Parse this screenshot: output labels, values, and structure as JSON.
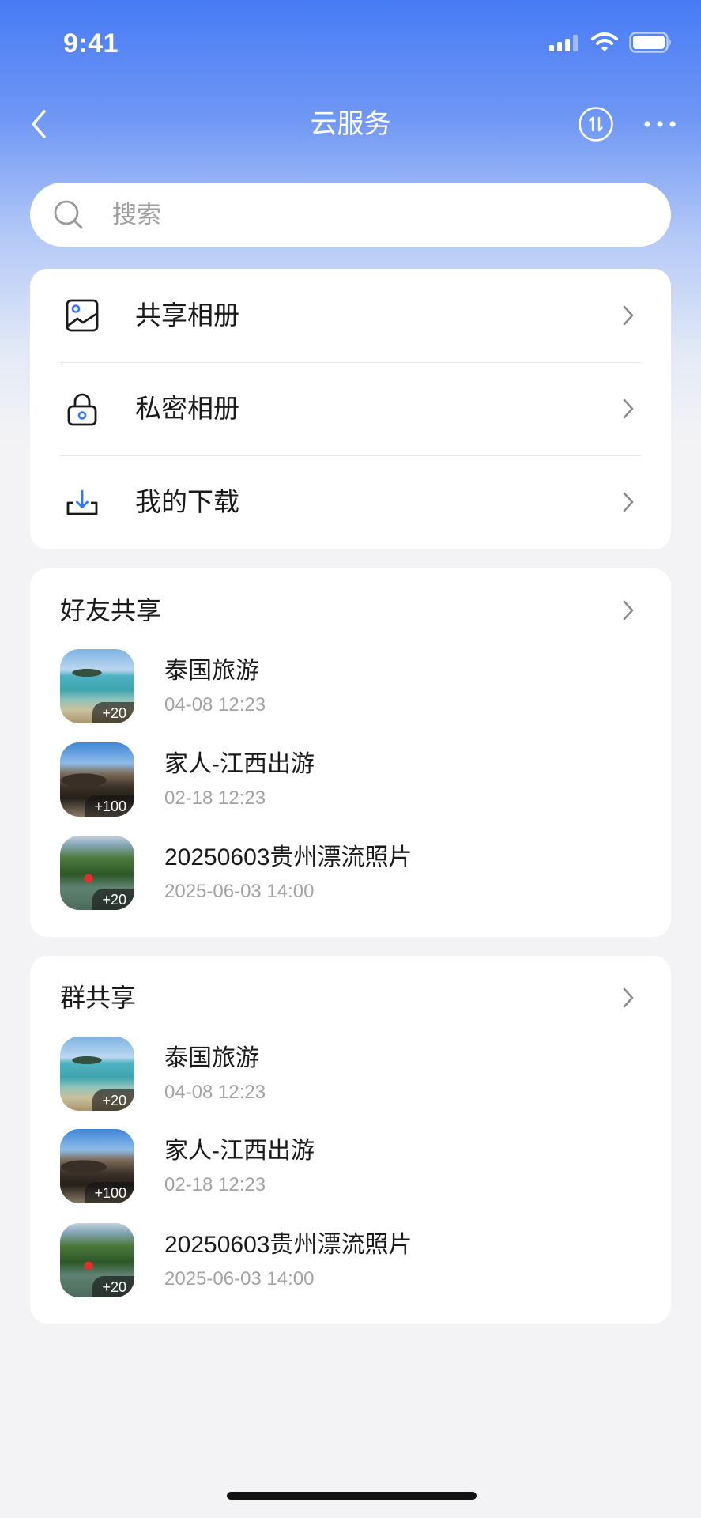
{
  "status_bar": {
    "time": "9:41",
    "icons": [
      "signal-icon",
      "wifi-icon",
      "battery-icon"
    ]
  },
  "nav": {
    "title": "云服务",
    "icons": {
      "back": "chevron-left-icon",
      "sort": "sort-icon",
      "more": "more-icon"
    }
  },
  "search": {
    "placeholder": "搜索",
    "icon": "search-icon"
  },
  "menu": [
    {
      "label": "共享相册",
      "icon": "image-icon"
    },
    {
      "label": "私密相册",
      "icon": "lock-icon"
    },
    {
      "label": "我的下载",
      "icon": "download-icon"
    }
  ],
  "friend_share": {
    "title": "好友共享",
    "items": [
      {
        "title": "泰国旅游",
        "date": "04-08 12:23",
        "count": "+20"
      },
      {
        "title": "家人-江西出游",
        "date": "02-18 12:23",
        "count": "+100"
      },
      {
        "title": "20250603贵州漂流照片",
        "date": "2025-06-03 14:00",
        "count": "+20"
      }
    ]
  },
  "group_share": {
    "title": "群共享",
    "items": [
      {
        "title": "泰国旅游",
        "date": "04-08 12:23",
        "count": "+20"
      },
      {
        "title": "家人-江西出游",
        "date": "02-18 12:23",
        "count": "+100"
      },
      {
        "title": "20250603贵州漂流照片",
        "date": "2025-06-03 14:00",
        "count": "+20"
      }
    ]
  },
  "colors": {
    "header_gradient_top": "#477bf5",
    "background": "#f3f3f5",
    "accent": "#3478f6",
    "text": "#1a1a1a",
    "secondary_text": "#a3a3a3"
  }
}
